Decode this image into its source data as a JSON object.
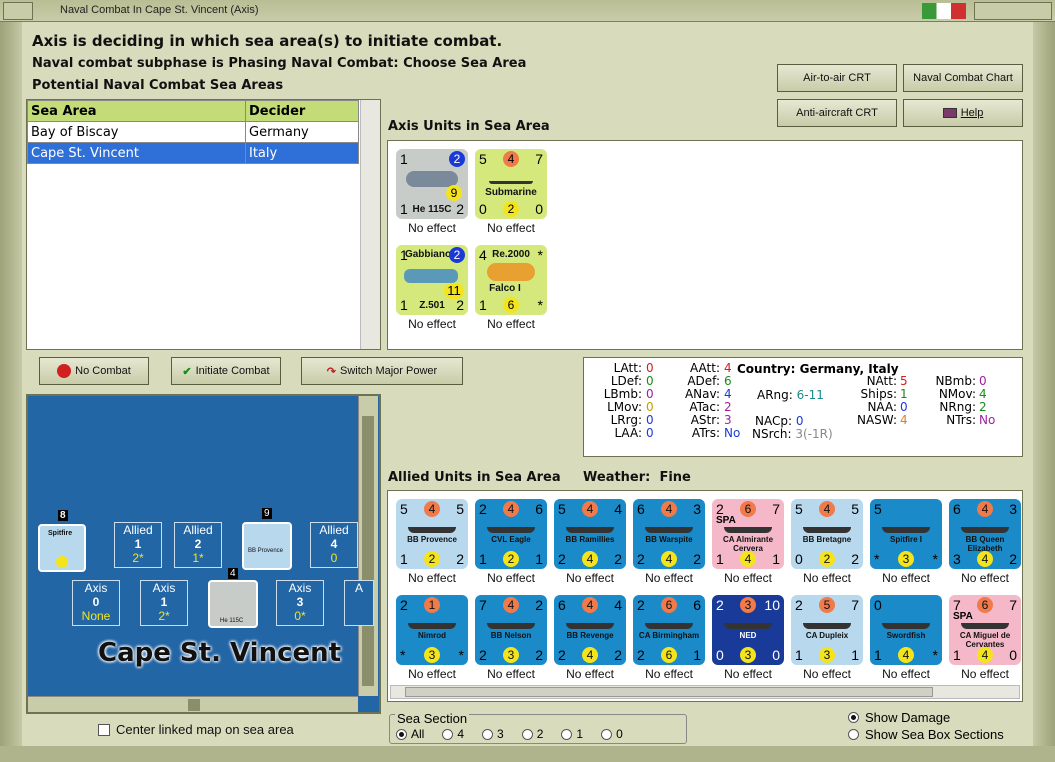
{
  "window": {
    "title": "Naval Combat In Cape St. Vincent (Axis)"
  },
  "messages": {
    "line1": "Axis is deciding in which sea area(s) to initiate combat.",
    "line2": "Naval combat subphase is Phasing Naval Combat: Choose Sea Area",
    "line3": "Potential Naval Combat Sea Areas"
  },
  "buttons": {
    "air_crt": "Air-to-air CRT",
    "naval_chart": "Naval Combat Chart",
    "aa_crt": "Anti-aircraft CRT",
    "help": "Help",
    "no_combat": "No Combat",
    "initiate": "Initiate Combat",
    "switch": "Switch Major Power"
  },
  "sea_table": {
    "headers": [
      "Sea Area",
      "Decider"
    ],
    "rows": [
      {
        "area": "Bay of Biscay",
        "decider": "Germany"
      },
      {
        "area": "Cape St. Vincent",
        "decider": "Italy"
      }
    ],
    "selected_index": 1
  },
  "axis_section": {
    "label": "Axis Units in Sea Area"
  },
  "allied_section": {
    "label": "Allied Units in Sea Area",
    "weather_label": "Weather:",
    "weather": "Fine"
  },
  "axis_units": [
    {
      "name": "He 115C",
      "tl": "1",
      "tr": "2",
      "br": "2",
      "bl": "1",
      "mid": "9",
      "effect": "No effect",
      "color": "#c8ccc8"
    },
    {
      "name": "Submarine",
      "tl": "5",
      "tm": "4",
      "tr": "7",
      "bl": "0",
      "bm": "2",
      "br": "0",
      "effect": "No effect",
      "color": "#d4e87c"
    },
    {
      "name": "Z.501",
      "top": "Gabbiano",
      "tl": "1",
      "tr": "2",
      "bl": "1",
      "br": "2",
      "mid": "11",
      "effect": "No effect",
      "color": "#d4e87c"
    },
    {
      "name": "Falco I",
      "top": "Re.2000",
      "tl": "4",
      "tr": "*",
      "bl": "1",
      "bm": "6",
      "br": "*",
      "effect": "No effect",
      "color": "#d4e87c"
    }
  ],
  "stats": {
    "col1": [
      [
        "LAtt:",
        "0"
      ],
      [
        "LDef:",
        "0"
      ],
      [
        "LBmb:",
        "0"
      ],
      [
        "LMov:",
        "0"
      ],
      [
        "LRrg:",
        "0"
      ],
      [
        "LAA:",
        "0"
      ]
    ],
    "col2": [
      [
        "AAtt:",
        "4"
      ],
      [
        "ADef:",
        "6"
      ],
      [
        "ANav:",
        "4"
      ],
      [
        "ATac:",
        "2"
      ],
      [
        "AStr:",
        "3"
      ],
      [
        "ATrs:",
        "No"
      ]
    ],
    "country_label": "Country:",
    "country": "Germany, Italy",
    "arng": [
      "ARng:",
      "6-11"
    ],
    "nacp": [
      "NACp:",
      "0"
    ],
    "nsrch": [
      "NSrch:",
      "3(-1R)"
    ],
    "col4": [
      [
        "NAtt:",
        "5"
      ],
      [
        "Ships:",
        "1"
      ],
      [
        "NAA:",
        "0"
      ],
      [
        "NASW:",
        "4"
      ]
    ],
    "col5": [
      [
        "NBmb:",
        "0"
      ],
      [
        "NMov:",
        "4"
      ],
      [
        "NRng:",
        "2"
      ],
      [
        "NTrs:",
        "No"
      ]
    ]
  },
  "allied_units_row1": [
    {
      "name": "BB Provence",
      "n": [
        "5",
        "4",
        "5",
        "1",
        "2",
        "2"
      ],
      "effect": "No effect"
    },
    {
      "name": "CVL Eagle",
      "n": [
        "2",
        "4",
        "6",
        "1",
        "2",
        "1"
      ],
      "effect": "No effect"
    },
    {
      "name": "BB Ramillies",
      "n": [
        "5",
        "4",
        "4",
        "2",
        "4",
        "2"
      ],
      "effect": "No effect"
    },
    {
      "name": "BB Warspite",
      "n": [
        "6",
        "4",
        "3",
        "2",
        "4",
        "2"
      ],
      "effect": "No effect"
    },
    {
      "name": "CA Almirante Cervera",
      "tag": "SPA",
      "n": [
        "2",
        "6",
        "7",
        "1",
        "4",
        "1"
      ],
      "effect": "No effect"
    },
    {
      "name": "BB Bretagne",
      "n": [
        "5",
        "4",
        "5",
        "0",
        "2",
        "2"
      ],
      "effect": "No effect"
    },
    {
      "name": "Spitfire I",
      "n": [
        "5",
        "",
        "",
        "*",
        "3",
        "*"
      ],
      "effect": "No effect"
    },
    {
      "name": "BB Queen Elizabeth",
      "n": [
        "6",
        "4",
        "3",
        "3",
        "4",
        "2"
      ],
      "effect": "No effect"
    }
  ],
  "allied_units_row2": [
    {
      "name": "Nimrod",
      "n": [
        "2",
        "1",
        "",
        "*",
        "3",
        "*"
      ],
      "effect": "No effect"
    },
    {
      "name": "BB Nelson",
      "n": [
        "7",
        "4",
        "2",
        "2",
        "3",
        "2"
      ],
      "effect": "No effect"
    },
    {
      "name": "BB Revenge",
      "n": [
        "6",
        "4",
        "4",
        "2",
        "4",
        "2"
      ],
      "effect": "No effect"
    },
    {
      "name": "CA Birmingham",
      "n": [
        "2",
        "6",
        "6",
        "2",
        "6",
        "1"
      ],
      "effect": "No effect"
    },
    {
      "name": "NED",
      "n": [
        "2",
        "3",
        "10",
        "0",
        "3",
        "0"
      ],
      "effect": "No effect"
    },
    {
      "name": "CA Dupleix",
      "n": [
        "2",
        "5",
        "7",
        "1",
        "3",
        "1"
      ],
      "effect": "No effect"
    },
    {
      "name": "Swordfish",
      "n": [
        "0",
        "",
        "",
        "1",
        "4",
        "*"
      ],
      "effect": "No effect"
    },
    {
      "name": "CA Miguel de Cervantes",
      "tag": "SPA",
      "n": [
        "7",
        "6",
        "7",
        "1",
        "4",
        "0"
      ],
      "effect": "No effect"
    }
  ],
  "map": {
    "title": "Cape St. Vincent",
    "allied_boxes": [
      {
        "label": "Allied",
        "num": "1",
        "sub": "2*"
      },
      {
        "label": "Allied",
        "num": "2",
        "sub": "1*"
      },
      {
        "label": "Allied",
        "num": "4",
        "sub": "0"
      }
    ],
    "axis_boxes": [
      {
        "label": "Axis",
        "num": "0",
        "sub": "None"
      },
      {
        "label": "Axis",
        "num": "1",
        "sub": "2*"
      },
      {
        "label": "Axis",
        "num": "3",
        "sub": "0*"
      },
      {
        "label": "A",
        "num": "",
        "sub": ""
      }
    ],
    "counters": {
      "spitfire_num": "8",
      "provence_num": "9",
      "he115_num": "4",
      "spitfire_label": "Spitfire",
      "provence_label": "BB Provence",
      "he115_label": "He 115C"
    }
  },
  "center_check": "Center linked map on sea area",
  "sea_section": {
    "label": "Sea Section",
    "options": [
      "All",
      "4",
      "3",
      "2",
      "1",
      "0"
    ],
    "selected": "All"
  },
  "options": {
    "show_damage": "Show Damage",
    "show_sections": "Show Sea Box Sections"
  }
}
